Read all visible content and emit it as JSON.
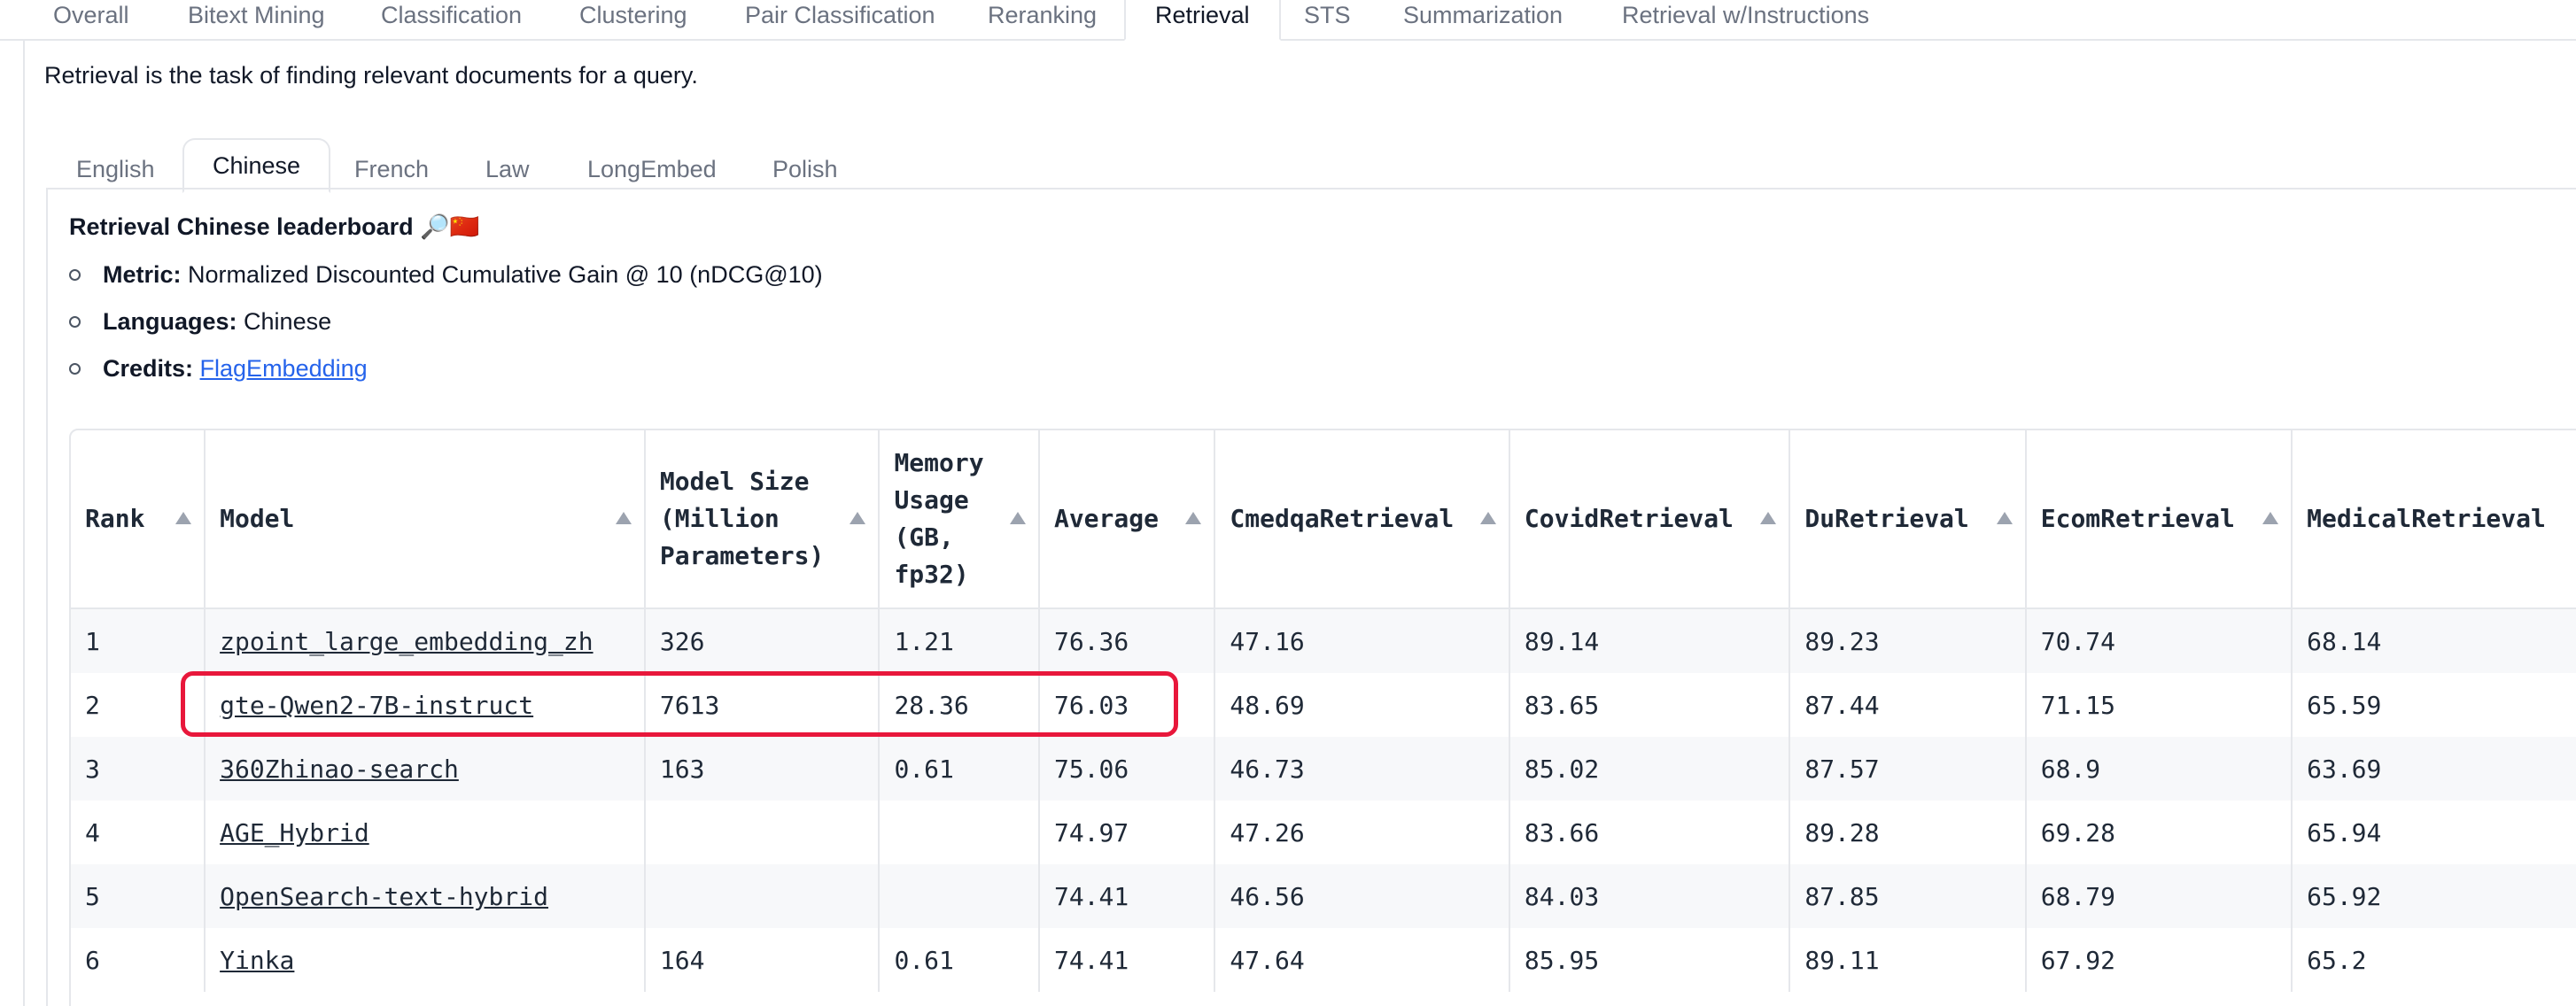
{
  "top_tabs": [
    {
      "label": "Overall"
    },
    {
      "label": "Bitext Mining"
    },
    {
      "label": "Classification"
    },
    {
      "label": "Clustering"
    },
    {
      "label": "Pair Classification"
    },
    {
      "label": "Reranking"
    },
    {
      "label": "Retrieval"
    },
    {
      "label": "STS"
    },
    {
      "label": "Summarization"
    },
    {
      "label": "Retrieval w/Instructions"
    }
  ],
  "active_top_tab": "Retrieval",
  "description": "Retrieval is the task of finding relevant documents for a query.",
  "sub_tabs": [
    {
      "label": "English"
    },
    {
      "label": "Chinese"
    },
    {
      "label": "French"
    },
    {
      "label": "Law"
    },
    {
      "label": "LongEmbed"
    },
    {
      "label": "Polish"
    }
  ],
  "active_sub_tab": "Chinese",
  "leaderboard": {
    "title": "Retrieval Chinese leaderboard",
    "title_emoji": "🔎🇨🇳",
    "metric_label": "Metric:",
    "metric_value": "Normalized Discounted Cumulative Gain @ 10 (nDCG@10)",
    "languages_label": "Languages:",
    "languages_value": "Chinese",
    "credits_label": "Credits:",
    "credits_link": "FlagEmbedding"
  },
  "table": {
    "headers": [
      "Rank",
      "Model",
      "Model Size (Million Parameters)",
      "Memory Usage (GB, fp32)",
      "Average",
      "CmedqaRetrieval",
      "CovidRetrieval",
      "DuRetrieval",
      "EcomRetrieval",
      "MedicalRetrieval"
    ],
    "rows": [
      [
        "1",
        "zpoint_large_embedding_zh",
        "326",
        "1.21",
        "76.36",
        "47.16",
        "89.14",
        "89.23",
        "70.74",
        "68.14"
      ],
      [
        "2",
        "gte-Qwen2-7B-instruct",
        "7613",
        "28.36",
        "76.03",
        "48.69",
        "83.65",
        "87.44",
        "71.15",
        "65.59"
      ],
      [
        "3",
        "360Zhinao-search",
        "163",
        "0.61",
        "75.06",
        "46.73",
        "85.02",
        "87.57",
        "68.9",
        "63.69"
      ],
      [
        "4",
        "AGE_Hybrid",
        "",
        "",
        "74.97",
        "47.26",
        "83.66",
        "89.28",
        "69.28",
        "65.94"
      ],
      [
        "5",
        "OpenSearch-text-hybrid",
        "",
        "",
        "74.41",
        "46.56",
        "84.03",
        "87.85",
        "68.79",
        "65.92"
      ],
      [
        "6",
        "Yinka",
        "164",
        "0.61",
        "74.41",
        "47.64",
        "85.95",
        "89.11",
        "67.92",
        "65.2"
      ]
    ]
  },
  "colors": {
    "highlight": "#e8173b",
    "link": "#2563eb",
    "border": "#e5e7eb"
  }
}
